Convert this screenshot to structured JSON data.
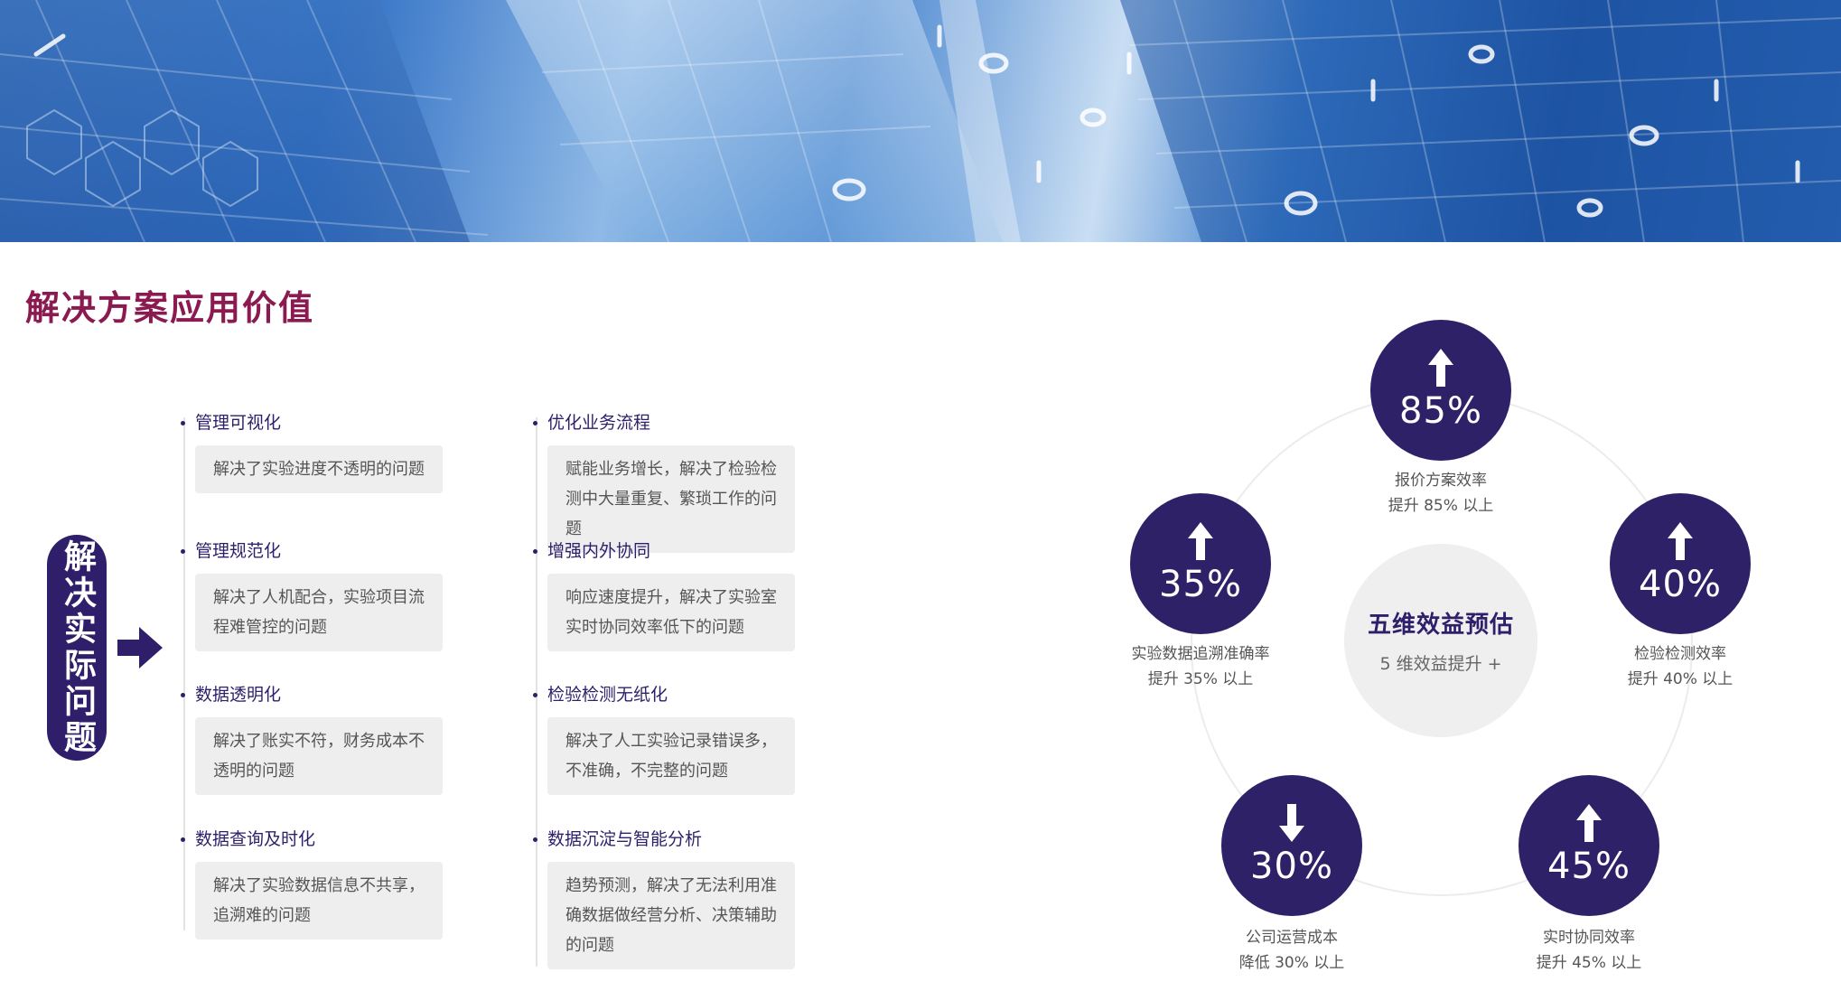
{
  "header": {
    "title": "解决方案应用价值"
  },
  "pill": {
    "label": "解决实际问题"
  },
  "left_column": [
    {
      "title": "管理可视化",
      "desc": "解决了实验进度不透明的问题"
    },
    {
      "title": "管理规范化",
      "desc": "解决了人机配合，实验项目流程难管控的问题"
    },
    {
      "title": "数据透明化",
      "desc": "解决了账实不符，财务成本不透明的问题"
    },
    {
      "title": "数据查询及时化",
      "desc": "解决了实验数据信息不共享，追溯难的问题"
    }
  ],
  "right_column": [
    {
      "title": "优化业务流程",
      "desc": "赋能业务增长，解决了检验检测中大量重复、繁琐工作的问题"
    },
    {
      "title": "增强内外协同",
      "desc": "响应速度提升，解决了实验室实时协同效率低下的问题"
    },
    {
      "title": "检验检测无纸化",
      "desc": "解决了人工实验记录错误多，不准确，不完整的问题"
    },
    {
      "title": "数据沉淀与智能分析",
      "desc": "趋势预测，解决了无法利用准确数据做经营分析、决策辅助的问题"
    }
  ],
  "center": {
    "title": "五维效益预估",
    "subtitle": "5 维效益提升 +"
  },
  "metrics": [
    {
      "value": "85%",
      "direction": "up",
      "label_line1": "报价方案效率",
      "label_line2": "提升 85% 以上"
    },
    {
      "value": "40%",
      "direction": "up",
      "label_line1": "检验检测效率",
      "label_line2": "提升 40% 以上"
    },
    {
      "value": "45%",
      "direction": "up",
      "label_line1": "实时协同效率",
      "label_line2": "提升 45% 以上"
    },
    {
      "value": "30%",
      "direction": "down",
      "label_line1": "公司运营成本",
      "label_line2": "降低 30% 以上"
    },
    {
      "value": "35%",
      "direction": "up",
      "label_line1": "实验数据追溯准确率",
      "label_line2": "提升 35% 以上"
    }
  ],
  "colors": {
    "title": "#8a1a4f",
    "accent": "#2e2168",
    "box_bg": "#eeeeee"
  }
}
